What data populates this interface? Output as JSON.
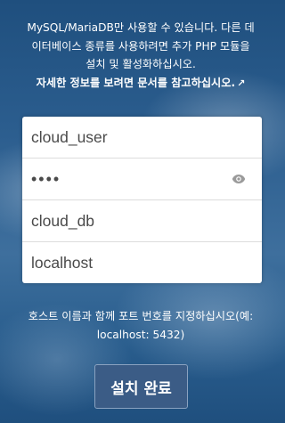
{
  "db_info": {
    "line1": "MySQL/MariaDB만 사용할 수 있습니다. 다른 데",
    "line2": "이터베이스 종류를 사용하려면 추가 PHP 모듈을",
    "line3": "설치 및 활성화하십시오.",
    "docs_link": "자세한 정보를 보려면 문서를 참고하십시오.",
    "docs_link_icon": "↗"
  },
  "form": {
    "db_user": "cloud_user",
    "db_password": "••••",
    "db_name": "cloud_db",
    "db_host": "localhost",
    "password_toggle_icon": "eye-icon"
  },
  "host_hint": {
    "line1": "호스트 이름과 함께 포트 번호를 지정하십시오(예:",
    "line2": "localhost: 5432)"
  },
  "finish_button": "설치 완료"
}
